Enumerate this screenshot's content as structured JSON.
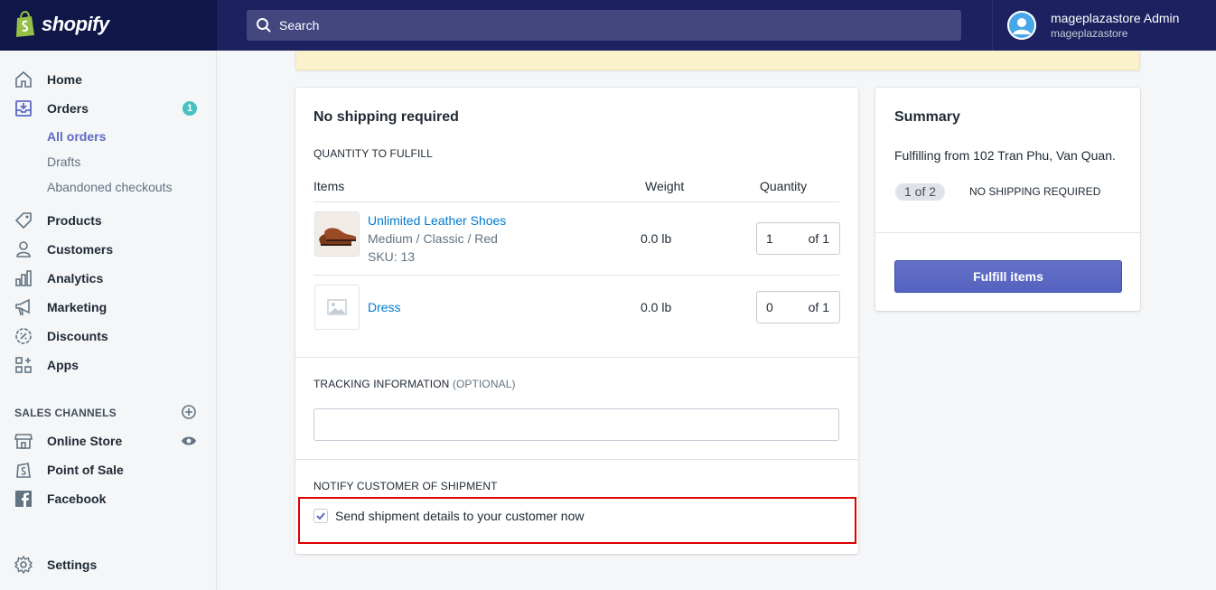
{
  "brand": {
    "name": "shopify"
  },
  "search": {
    "placeholder": "Search"
  },
  "user": {
    "name": "mageplazastore Admin",
    "store": "mageplazastore"
  },
  "sidebar": {
    "items": [
      {
        "label": "Home",
        "icon": "home-icon"
      },
      {
        "label": "Orders",
        "icon": "orders-icon",
        "badge": "1"
      },
      {
        "label": "Products",
        "icon": "tag-icon"
      },
      {
        "label": "Customers",
        "icon": "person-icon"
      },
      {
        "label": "Analytics",
        "icon": "bar-chart-icon"
      },
      {
        "label": "Marketing",
        "icon": "megaphone-icon"
      },
      {
        "label": "Discounts",
        "icon": "discount-icon"
      },
      {
        "label": "Apps",
        "icon": "apps-icon"
      }
    ],
    "orders_sub": [
      "All orders",
      "Drafts",
      "Abandoned checkouts"
    ],
    "channels_title": "SALES CHANNELS",
    "channels": [
      {
        "label": "Online Store",
        "icon": "store-icon"
      },
      {
        "label": "Point of Sale",
        "icon": "pos-icon"
      },
      {
        "label": "Facebook",
        "icon": "facebook-icon"
      }
    ],
    "settings": "Settings"
  },
  "fulfillment": {
    "title": "No shipping required",
    "qty_section": "QUANTITY TO FULFILL",
    "columns": {
      "items": "Items",
      "weight": "Weight",
      "quantity": "Quantity"
    },
    "rows": [
      {
        "name": "Unlimited Leather Shoes",
        "variant": "Medium / Classic / Red",
        "sku": "SKU: 13",
        "weight": "0.0 lb",
        "qty": "1",
        "of": "of 1"
      },
      {
        "name": "Dress",
        "weight": "0.0 lb",
        "qty": "0",
        "of": "of 1"
      }
    ],
    "tracking_title": "TRACKING INFORMATION",
    "tracking_optional": "(OPTIONAL)",
    "notify_title": "NOTIFY CUSTOMER OF SHIPMENT",
    "notify_label": "Send shipment details to your customer now",
    "notify_checked": true
  },
  "summary": {
    "title": "Summary",
    "from": "Fulfilling from 102 Tran Phu, Van Quan.",
    "count": "1 of 2",
    "status": "NO SHIPPING REQUIRED",
    "button": "Fulfill items"
  },
  "colors": {
    "topbar": "#1c2260",
    "accent": "#5c6ac4",
    "link": "#007ace",
    "highlight": "#e00000"
  }
}
